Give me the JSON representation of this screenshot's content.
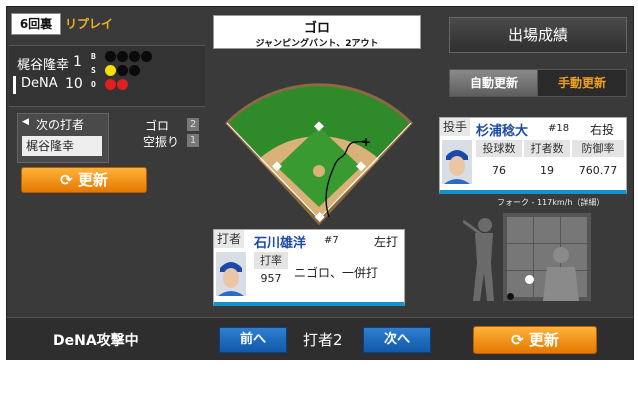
{
  "inning": "6回裏",
  "replay_label": "リプレイ",
  "scoreboard": {
    "teams": [
      {
        "name": "梶谷隆幸",
        "score": "1"
      },
      {
        "name": "DeNA",
        "score": "10"
      }
    ],
    "bso_labels": [
      "B",
      "S",
      "O"
    ],
    "balls": 0,
    "strikes": 1,
    "outs": 2
  },
  "next_batter": {
    "label": "次の打者",
    "name": "梶谷隆幸"
  },
  "stats_small": [
    {
      "label": "ゴロ",
      "value": "2"
    },
    {
      "label": "空振り",
      "value": "1"
    }
  ],
  "update_label": "更新",
  "play_result": {
    "main": "ゴロ",
    "sub": "ジャンピングバント、2アウト"
  },
  "pitcher": {
    "role": "投手",
    "name": "杉浦稔大",
    "number": "#18",
    "hand": "右投",
    "headers": [
      "投球数",
      "打者数",
      "防御率"
    ],
    "values": [
      "76",
      "19",
      "760.77"
    ]
  },
  "batter": {
    "role": "打者",
    "name": "石川雄洋",
    "number": "#7",
    "hand": "左打",
    "avg_label": "打率",
    "avg_value": "957",
    "result": "ニゴロ、一併打"
  },
  "right_panel": {
    "appearance_label": "出場成績",
    "auto_label": "自動更新",
    "manual_label": "手動更新"
  },
  "pitch_info": "フォーク - 117km/h（詳細）",
  "bottom": {
    "attack_label": "DeNA攻撃中",
    "prev_label": "前へ",
    "batter_index": "打者2",
    "next_label": "次へ",
    "update_label": "更新"
  },
  "colors": {
    "accent_orange": "#f08a10",
    "nav_blue": "#1a66b8",
    "field_green": "#2f8a2a"
  }
}
